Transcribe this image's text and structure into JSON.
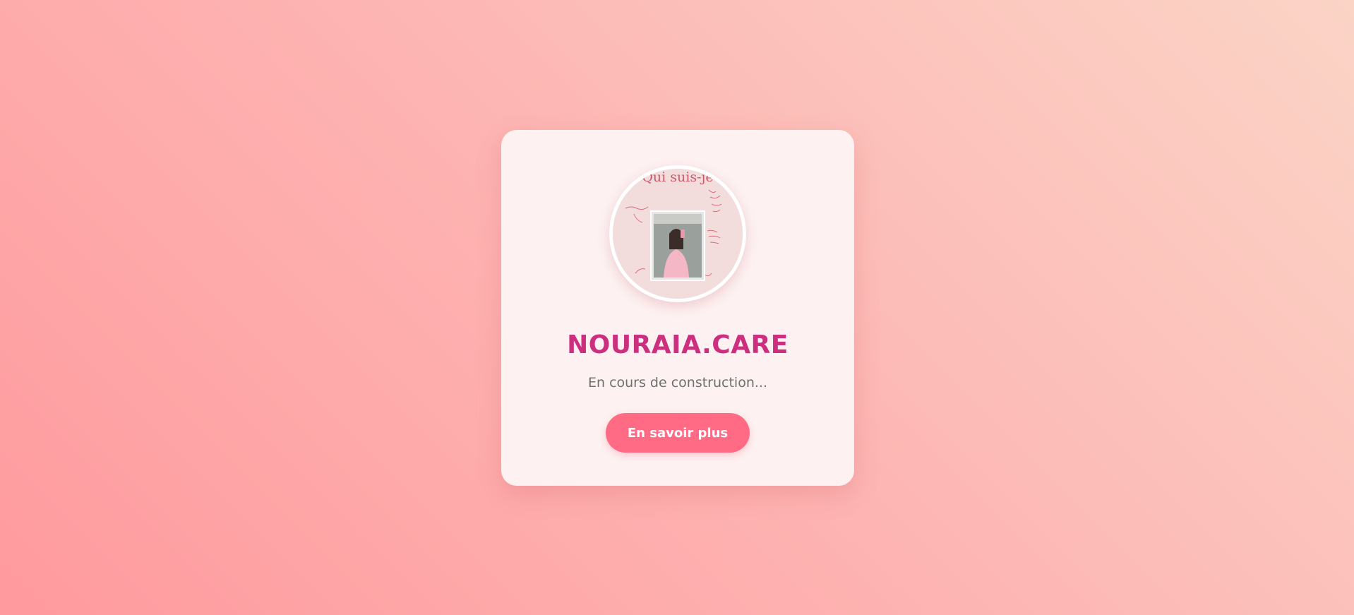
{
  "brand": {
    "name": "NOURAIA.CARE",
    "tagline": "En cours de construction..."
  },
  "cta": {
    "label": "En savoir plus"
  },
  "avatar": {
    "handwritten_heading": "Qui suis-je"
  },
  "colors": {
    "title": "#cc2f7e",
    "button": "#ff6b84",
    "card": "#fdf1f1",
    "subtitle": "#6f6f6f"
  }
}
